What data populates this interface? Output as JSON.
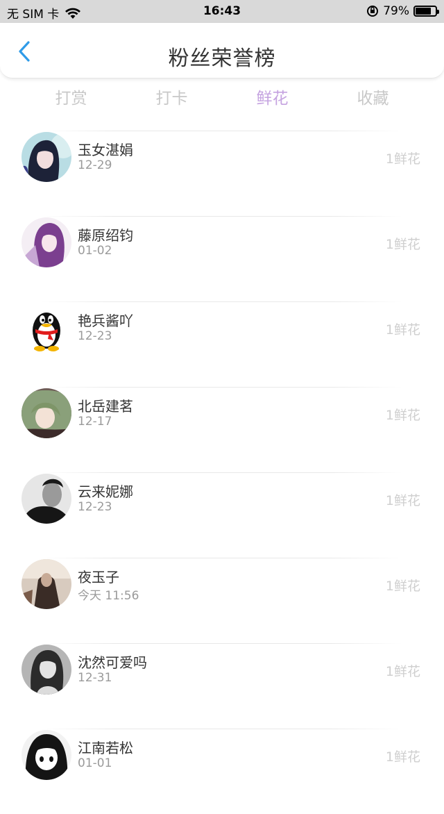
{
  "status_bar": {
    "carrier": "无 SIM 卡",
    "time": "16:43",
    "battery_pct": "79%"
  },
  "header": {
    "title": "粉丝荣誉榜",
    "accent": "#2f9be8"
  },
  "tabs": [
    {
      "label": "打赏",
      "active": false
    },
    {
      "label": "打卡",
      "active": false
    },
    {
      "label": "鲜花",
      "active": true
    },
    {
      "label": "收藏",
      "active": false
    }
  ],
  "fans": [
    {
      "name": "玉女湛娟",
      "date": "12-29",
      "count": "1鲜花",
      "avatar": "anime-girl-dark-hair"
    },
    {
      "name": "藤原绍钧",
      "date": "01-02",
      "count": "1鲜花",
      "avatar": "anime-purple-hair"
    },
    {
      "name": "艳兵酱吖",
      "date": "12-23",
      "count": "1鲜花",
      "avatar": "qq-penguin"
    },
    {
      "name": "北岳建茗",
      "date": "12-17",
      "count": "1鲜花",
      "avatar": "anime-green-hair"
    },
    {
      "name": "云来妮娜",
      "date": "12-23",
      "count": "1鲜花",
      "avatar": "man-portrait-bw"
    },
    {
      "name": "夜玉子",
      "date": "今天 11:56",
      "count": "1鲜花",
      "avatar": "sepia-photo"
    },
    {
      "name": "沈然可爱吗",
      "date": "12-31",
      "count": "1鲜花",
      "avatar": "woman-portrait-bw"
    },
    {
      "name": "江南若松",
      "date": "01-01",
      "count": "1鲜花",
      "avatar": "manga-girl"
    }
  ]
}
